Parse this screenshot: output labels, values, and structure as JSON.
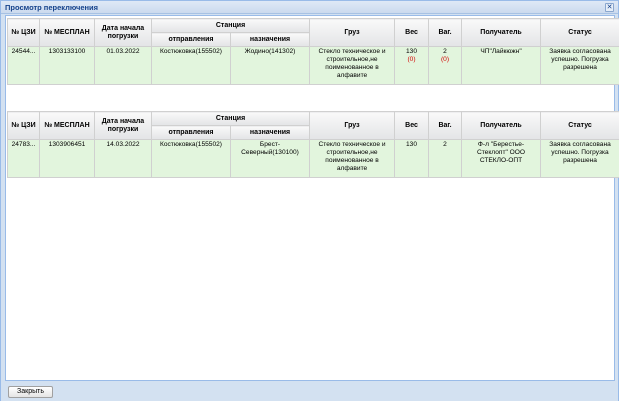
{
  "window": {
    "title": "Просмотр переключения"
  },
  "headers": {
    "czi": "№ ЦЗИ",
    "mesplan": "№ МЕСПЛАН",
    "date": "Дата начала погрузки",
    "station": "Станция",
    "departure": "отправления",
    "destination": "назначения",
    "cargo": "Груз",
    "weight": "Вес",
    "wagons": "Ваг.",
    "recipient": "Получатель",
    "status": "Статус"
  },
  "table_top": {
    "rows": [
      {
        "czi": "24544...",
        "mesplan": "1303133100",
        "date": "01.03.2022",
        "departure": "Костюковка(155502)",
        "destination": "Жодино(141302)",
        "cargo": "Стекло техническое и строительное,не поименованное в алфавите",
        "weight": "130",
        "weight_sub": "(0)",
        "wagons": "2",
        "wagons_sub": "(0)",
        "recipient": "ЧП\"Лайкюжн\"",
        "status": "Заявка согласована успешно. Погрузка разрешена"
      }
    ]
  },
  "table_bottom": {
    "rows": [
      {
        "czi": "24783...",
        "mesplan": "1303906451",
        "date": "14.03.2022",
        "departure": "Костюковка(155502)",
        "destination": "Брест-Северный(130100)",
        "cargo": "Стекло техническое и строительное,не поименованное в алфавите",
        "weight": "130",
        "wagons": "2",
        "recipient": "Ф-л \"Берестье-Стеклопт\" ООО СТЕКЛО-ОПТ",
        "status": "Заявка согласована успешно. Погрузка разрешена"
      }
    ]
  },
  "footer": {
    "close_label": "Закрыть"
  }
}
